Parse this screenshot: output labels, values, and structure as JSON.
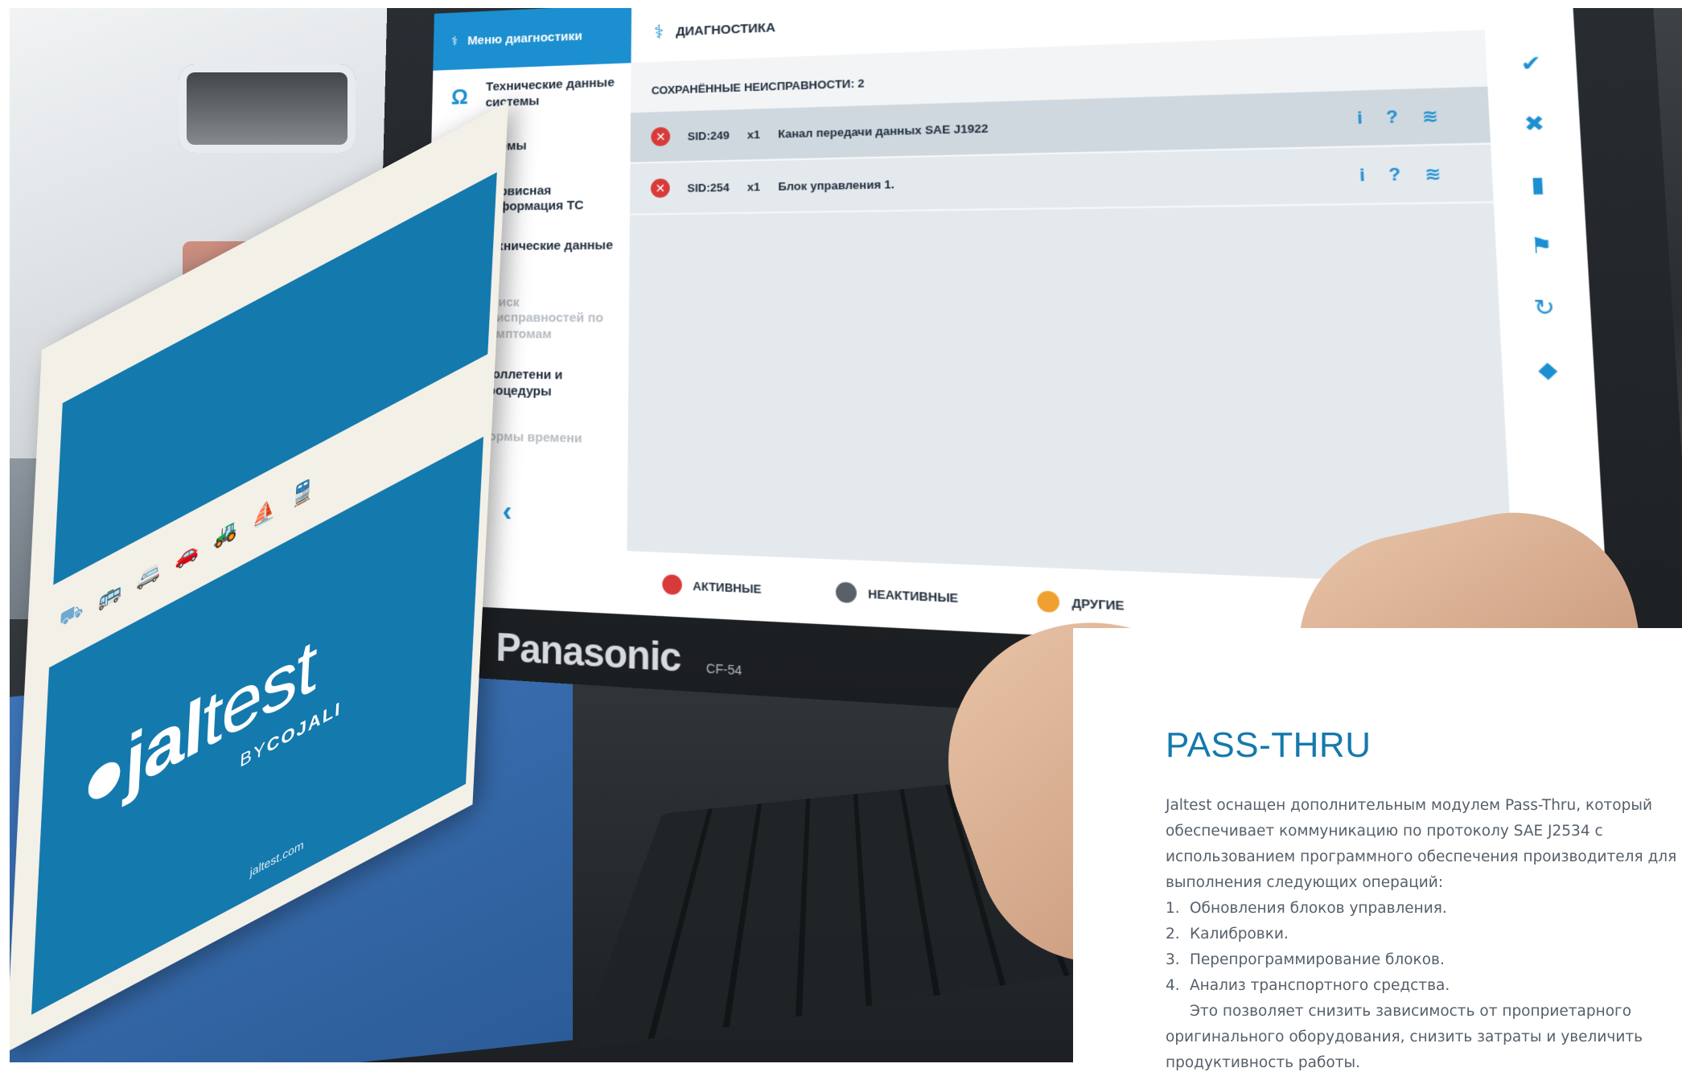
{
  "laptop": {
    "brand": "Panasonic",
    "model": "CF-54",
    "sidebar": {
      "header": "Меню диагностики",
      "items": [
        {
          "label": "Технические данные системы",
          "icon": "omega-icon",
          "enabled": true
        },
        {
          "label": "Схемы",
          "icon": "schematic-icon",
          "enabled": true
        },
        {
          "label": "Сервисная информация ТС",
          "icon": "oil-can-icon",
          "enabled": true
        },
        {
          "label": "Технические данные ТС",
          "icon": "wrench-icon",
          "enabled": true
        },
        {
          "label": "Поиск неисправностей по симптомам",
          "icon": "tools-icon",
          "enabled": false
        },
        {
          "label": "Бюллетени и процедуры",
          "icon": "document-icon",
          "enabled": true
        },
        {
          "label": "Нормы времени",
          "icon": "gear-clock-icon",
          "enabled": false
        }
      ]
    },
    "main": {
      "title": "ДИАГНОСТИКА",
      "saved_faults": "СОХРАНЁННЫЕ НЕИСПРАВНОСТИ: 2",
      "faults": [
        {
          "code": "SID:249",
          "count": "x1",
          "text": "Канал передачи данных SAE J1922"
        },
        {
          "code": "SID:254",
          "count": "x1",
          "text": "Блок управления 1."
        }
      ],
      "filters": [
        {
          "label": "АКТИВНЫЕ",
          "color": "#d83a3a"
        },
        {
          "label": "НЕАКТИВНЫЕ",
          "color": "#5a6068"
        },
        {
          "label": "ДРУГИЕ",
          "color": "#f0a030"
        }
      ]
    }
  },
  "booklet": {
    "logo_bold": "jal",
    "logo_light": "test",
    "by_prefix": "BY",
    "by_brand": "COJALI",
    "url": "jaltest.com"
  },
  "panel": {
    "title": "PASS-THRU",
    "intro": "Jaltest оснащен дополнительным модулем Pass-Thru, который обеспечивает коммуникацию по протоколу SAE J2534 с использованием программного обеспечения производителя для выполнения следующих операций:",
    "list": [
      {
        "num": "1.",
        "text": "Обновления блоков управления."
      },
      {
        "num": "2.",
        "text": "Калибровки."
      },
      {
        "num": "3.",
        "text": "Перепрограммирование блоков."
      },
      {
        "num": "4.",
        "text": "Анализ транспортного средства."
      }
    ],
    "outro": "Это позволяет снизить зависимость от проприетарного оригинального оборудования, снизить затраты и увеличить продуктивность работы."
  },
  "colors": {
    "accent": "#1479ad",
    "ui_blue": "#1b8fd0",
    "body_text": "#56606a"
  }
}
